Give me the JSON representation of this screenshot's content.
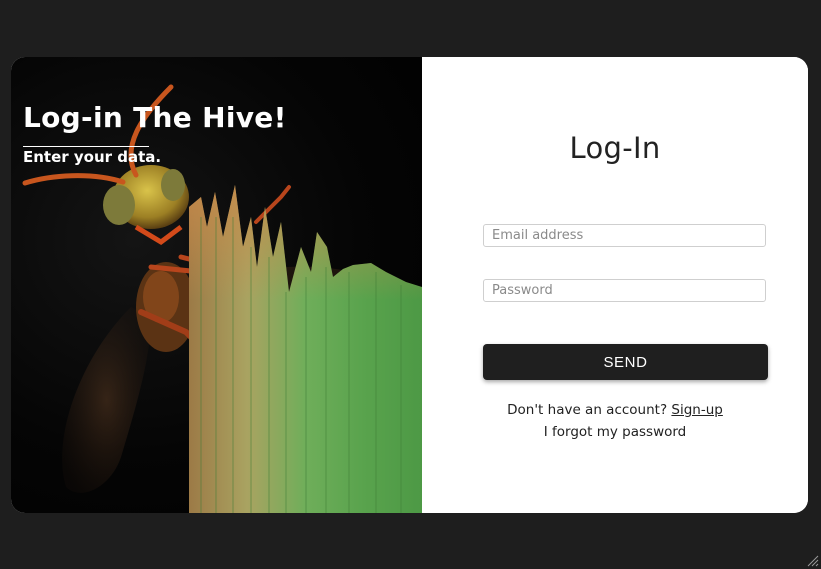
{
  "hero": {
    "title": "Log-in The Hive!",
    "subtitle": "Enter your data.",
    "image": "wasp-on-grass-blade-photo"
  },
  "form": {
    "title": "Log-In",
    "email": {
      "value": "",
      "placeholder": "Email address"
    },
    "password": {
      "value": "",
      "placeholder": "Password"
    },
    "send_label": "SEND",
    "signup_prompt": "Don't have an account? ",
    "signup_link": "Sign-up",
    "forgot_link": "I forgot my password"
  },
  "colors": {
    "page_background": "#1e1e1e",
    "card_background": "#ffffff",
    "button_background": "#1f1f1f",
    "button_text": "#ffffff"
  },
  "icons": {
    "resize_grip": "resize-grip-icon"
  }
}
